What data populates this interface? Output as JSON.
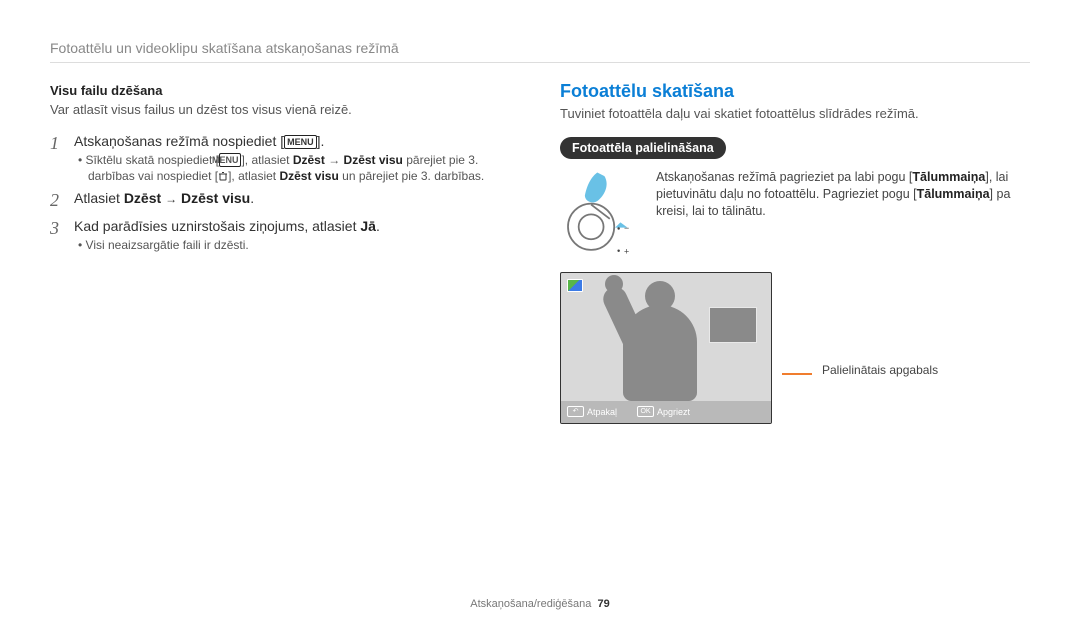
{
  "page_header": "Fotoattēlu un videoklipu skatīšana atskaņošanas režīmā",
  "left": {
    "heading_bold": "Visu failu dzēšana",
    "desc": "Var atlasīt visus failus un dzēst tos visus vienā reizē.",
    "steps": [
      {
        "num": "1",
        "main_a": "Atskaņošanas režīmā nospiediet [",
        "main_b": "].",
        "sub1_a": "Sīktēlu skatā nospiediet [",
        "sub1_b": "], atlasiet ",
        "sub1_c": "Dzēst",
        "sub1_d": "Dzēst visu",
        "sub1_e": " pārejiet pie 3. darbības vai nospiediet [",
        "sub1_f": "], atlasiet ",
        "sub1_g": "Dzēst visu",
        "sub1_h": " un pārejiet pie 3. darbības."
      },
      {
        "num": "2",
        "main_a": "Atlasiet ",
        "main_b": "Dzēst",
        "main_c": "Dzēst visu",
        "main_d": "."
      },
      {
        "num": "3",
        "main_a": "Kad parādīsies uznirstošais ziņojums, atlasiet ",
        "main_b": "Jā",
        "main_c": ".",
        "sub": "Visi neaizsargātie faili ir dzēsti."
      }
    ]
  },
  "right": {
    "title": "Fotoattēlu skatīšana",
    "desc": "Tuviniet fotoattēla daļu vai skatiet fotoattēlus slīdrādes režīmā.",
    "pill": "Fotoattēla palielināšana",
    "zoom_text_a": "Atskaņošanas režīmā pagrieziet pa labi pogu [",
    "zoom_text_b": "Tālummaiņa",
    "zoom_text_c": "], lai pietuvinātu daļu no fotoattēlu. Pagrieziet pogu [",
    "zoom_text_d": "Tālummaiņa",
    "zoom_text_e": "] pa kreisi, lai to tālinātu.",
    "screen": {
      "back": "Atpakaļ",
      "crop": "Apgriezt",
      "ok": "OK"
    },
    "leader": "Palielinātais apgabals"
  },
  "symbols": {
    "minus": "−",
    "plus": "+",
    "arrow": "→",
    "back_arrow": "↶"
  },
  "menu_label": "MENU",
  "footer": {
    "section": "Atskaņošana/rediģēšana",
    "page": "79"
  }
}
